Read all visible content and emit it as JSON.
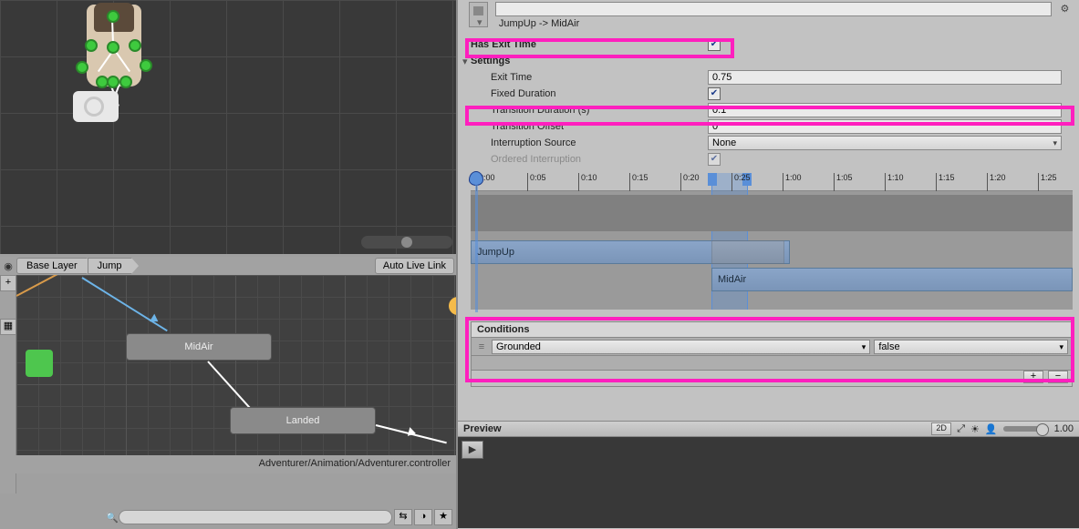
{
  "inspector": {
    "transition_name": "JumpUp -> MidAir",
    "has_exit_time": {
      "label": "Has Exit Time",
      "checked": true
    },
    "settings_label": "Settings",
    "exit_time": {
      "label": "Exit Time",
      "value": "0.75"
    },
    "fixed_duration": {
      "label": "Fixed Duration",
      "checked": true
    },
    "transition_duration": {
      "label": "Transition Duration (s)",
      "value": "0.1"
    },
    "transition_offset": {
      "label": "Transition Offset",
      "value": "0"
    },
    "interruption_source": {
      "label": "Interruption Source",
      "value": "None"
    },
    "ordered_interruption": {
      "label": "Ordered Interruption",
      "checked": true
    }
  },
  "timeline": {
    "ticks": [
      "0:00",
      "0:05",
      "0:10",
      "0:15",
      "0:20",
      "0:25",
      "1:00",
      "1:05",
      "1:10",
      "1:15",
      "1:20",
      "1:25"
    ],
    "clip_a": "JumpUp",
    "clip_b": "MidAir"
  },
  "conditions": {
    "header": "Conditions",
    "rows": [
      {
        "param": "Grounded",
        "value": "false"
      }
    ]
  },
  "animator": {
    "breadcrumb": [
      "Base Layer",
      "Jump"
    ],
    "auto_live_link": "Auto Live Link",
    "states": {
      "midair": "MidAir",
      "landed": "Landed"
    },
    "asset_path": "Adventurer/Animation/Adventurer.controller"
  },
  "preview": {
    "title": "Preview",
    "mode": "2D",
    "speed": "1.00"
  }
}
